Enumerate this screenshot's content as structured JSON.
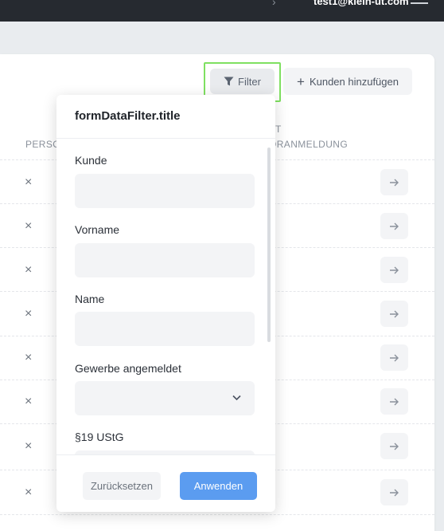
{
  "topbar": {
    "user_email": "test1@klein-ut.com",
    "chevron": "›"
  },
  "toolbar": {
    "filter_label": "Filter",
    "add_label": "Kunden hinzufügen",
    "add_symbol": "+"
  },
  "table": {
    "headers": {
      "person": "PERSO",
      "col_right_line1": "T",
      "col_right_line2": "ORANMELDUNG"
    },
    "row_count": 8,
    "row_marker": "×"
  },
  "filter_popover": {
    "title": "formDataFilter.title",
    "fields": [
      {
        "label": "Kunde",
        "value": ""
      },
      {
        "label": "Vorname",
        "value": ""
      },
      {
        "label": "Name",
        "value": ""
      },
      {
        "label": "Gewerbe angemeldet",
        "value": ""
      },
      {
        "label": "§19 UStG",
        "value": ""
      }
    ],
    "reset_label": "Zurücksetzen",
    "apply_label": "Anwenden"
  },
  "colors": {
    "accent": "#5b9cf0",
    "highlight": "#7fe061",
    "navbar": "#262a30"
  },
  "icons": {
    "filter": "filter-funnel-icon",
    "add": "plus-icon",
    "row_remove": "close-icon",
    "row_open": "arrow-right-icon",
    "select": "chevron-down-icon"
  }
}
